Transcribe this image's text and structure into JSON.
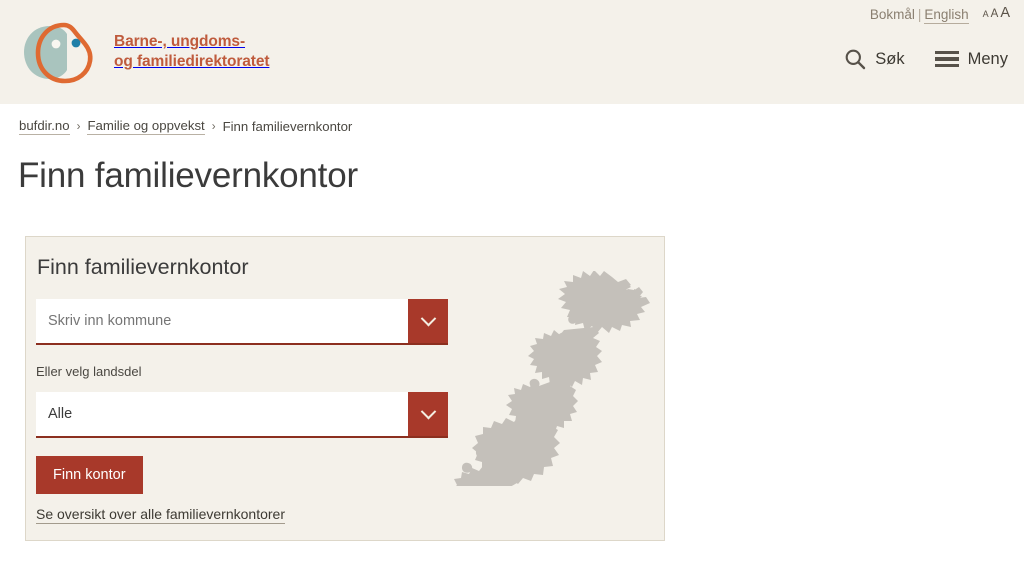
{
  "header": {
    "logo": {
      "icon": "bufdir-bird-logo",
      "text": "Barne-, ungdoms-\nog familiedirektoratet",
      "colors": {
        "orange": "#bf5b3d",
        "teal": "#a9c4be",
        "blue": "#1f7fa8"
      }
    },
    "language": {
      "primary": "Bokmål",
      "separator": "|",
      "secondary": "English"
    },
    "text_size": {
      "small": "A",
      "medium": "A",
      "large": "A"
    },
    "nav": [
      {
        "icon": "search-icon",
        "label": "Søk"
      },
      {
        "icon": "hamburger-menu-icon",
        "label": "Meny"
      }
    ]
  },
  "breadcrumb": {
    "items": [
      {
        "label": "bufdir.no",
        "is_link": true
      },
      {
        "label": "Familie og oppvekst",
        "is_link": true
      },
      {
        "label": "Finn familievernkontor",
        "is_link": false
      }
    ],
    "separator": "›"
  },
  "page": {
    "title": "Finn familievernkontor"
  },
  "finder": {
    "title": "Finn familievernkontor",
    "municipality": {
      "placeholder": "Skriv inn kommune",
      "value": "",
      "dropdown_icon": "chevron-down-icon"
    },
    "region": {
      "label": "Eller velg landsdel",
      "value": "Alle",
      "dropdown_icon": "chevron-down-icon"
    },
    "submit_label": "Finn kontor",
    "overview_link": "Se oversikt over alle familievernkontorer",
    "map": {
      "name": "norway-map",
      "fill": "#c4c0ba"
    }
  },
  "colors": {
    "header_bg": "#f4f1ea",
    "card_bg": "#f4f1ea",
    "card_border": "#ddd7c9",
    "accent_red": "#a8392a",
    "input_underline": "#8c2f1f",
    "logo_orange": "#bf5b3d",
    "page_bg": "#ffffff"
  }
}
